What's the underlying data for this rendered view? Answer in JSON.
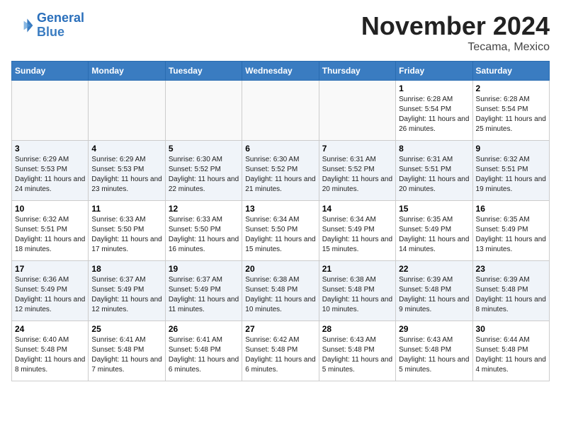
{
  "header": {
    "logo_line1": "General",
    "logo_line2": "Blue",
    "month_title": "November 2024",
    "location": "Tecama, Mexico"
  },
  "days_of_week": [
    "Sunday",
    "Monday",
    "Tuesday",
    "Wednesday",
    "Thursday",
    "Friday",
    "Saturday"
  ],
  "weeks": [
    [
      {
        "day": "",
        "info": ""
      },
      {
        "day": "",
        "info": ""
      },
      {
        "day": "",
        "info": ""
      },
      {
        "day": "",
        "info": ""
      },
      {
        "day": "",
        "info": ""
      },
      {
        "day": "1",
        "info": "Sunrise: 6:28 AM\nSunset: 5:54 PM\nDaylight: 11 hours and 26 minutes."
      },
      {
        "day": "2",
        "info": "Sunrise: 6:28 AM\nSunset: 5:54 PM\nDaylight: 11 hours and 25 minutes."
      }
    ],
    [
      {
        "day": "3",
        "info": "Sunrise: 6:29 AM\nSunset: 5:53 PM\nDaylight: 11 hours and 24 minutes."
      },
      {
        "day": "4",
        "info": "Sunrise: 6:29 AM\nSunset: 5:53 PM\nDaylight: 11 hours and 23 minutes."
      },
      {
        "day": "5",
        "info": "Sunrise: 6:30 AM\nSunset: 5:52 PM\nDaylight: 11 hours and 22 minutes."
      },
      {
        "day": "6",
        "info": "Sunrise: 6:30 AM\nSunset: 5:52 PM\nDaylight: 11 hours and 21 minutes."
      },
      {
        "day": "7",
        "info": "Sunrise: 6:31 AM\nSunset: 5:52 PM\nDaylight: 11 hours and 20 minutes."
      },
      {
        "day": "8",
        "info": "Sunrise: 6:31 AM\nSunset: 5:51 PM\nDaylight: 11 hours and 20 minutes."
      },
      {
        "day": "9",
        "info": "Sunrise: 6:32 AM\nSunset: 5:51 PM\nDaylight: 11 hours and 19 minutes."
      }
    ],
    [
      {
        "day": "10",
        "info": "Sunrise: 6:32 AM\nSunset: 5:51 PM\nDaylight: 11 hours and 18 minutes."
      },
      {
        "day": "11",
        "info": "Sunrise: 6:33 AM\nSunset: 5:50 PM\nDaylight: 11 hours and 17 minutes."
      },
      {
        "day": "12",
        "info": "Sunrise: 6:33 AM\nSunset: 5:50 PM\nDaylight: 11 hours and 16 minutes."
      },
      {
        "day": "13",
        "info": "Sunrise: 6:34 AM\nSunset: 5:50 PM\nDaylight: 11 hours and 15 minutes."
      },
      {
        "day": "14",
        "info": "Sunrise: 6:34 AM\nSunset: 5:49 PM\nDaylight: 11 hours and 15 minutes."
      },
      {
        "day": "15",
        "info": "Sunrise: 6:35 AM\nSunset: 5:49 PM\nDaylight: 11 hours and 14 minutes."
      },
      {
        "day": "16",
        "info": "Sunrise: 6:35 AM\nSunset: 5:49 PM\nDaylight: 11 hours and 13 minutes."
      }
    ],
    [
      {
        "day": "17",
        "info": "Sunrise: 6:36 AM\nSunset: 5:49 PM\nDaylight: 11 hours and 12 minutes."
      },
      {
        "day": "18",
        "info": "Sunrise: 6:37 AM\nSunset: 5:49 PM\nDaylight: 11 hours and 12 minutes."
      },
      {
        "day": "19",
        "info": "Sunrise: 6:37 AM\nSunset: 5:49 PM\nDaylight: 11 hours and 11 minutes."
      },
      {
        "day": "20",
        "info": "Sunrise: 6:38 AM\nSunset: 5:48 PM\nDaylight: 11 hours and 10 minutes."
      },
      {
        "day": "21",
        "info": "Sunrise: 6:38 AM\nSunset: 5:48 PM\nDaylight: 11 hours and 10 minutes."
      },
      {
        "day": "22",
        "info": "Sunrise: 6:39 AM\nSunset: 5:48 PM\nDaylight: 11 hours and 9 minutes."
      },
      {
        "day": "23",
        "info": "Sunrise: 6:39 AM\nSunset: 5:48 PM\nDaylight: 11 hours and 8 minutes."
      }
    ],
    [
      {
        "day": "24",
        "info": "Sunrise: 6:40 AM\nSunset: 5:48 PM\nDaylight: 11 hours and 8 minutes."
      },
      {
        "day": "25",
        "info": "Sunrise: 6:41 AM\nSunset: 5:48 PM\nDaylight: 11 hours and 7 minutes."
      },
      {
        "day": "26",
        "info": "Sunrise: 6:41 AM\nSunset: 5:48 PM\nDaylight: 11 hours and 6 minutes."
      },
      {
        "day": "27",
        "info": "Sunrise: 6:42 AM\nSunset: 5:48 PM\nDaylight: 11 hours and 6 minutes."
      },
      {
        "day": "28",
        "info": "Sunrise: 6:43 AM\nSunset: 5:48 PM\nDaylight: 11 hours and 5 minutes."
      },
      {
        "day": "29",
        "info": "Sunrise: 6:43 AM\nSunset: 5:48 PM\nDaylight: 11 hours and 5 minutes."
      },
      {
        "day": "30",
        "info": "Sunrise: 6:44 AM\nSunset: 5:48 PM\nDaylight: 11 hours and 4 minutes."
      }
    ]
  ]
}
